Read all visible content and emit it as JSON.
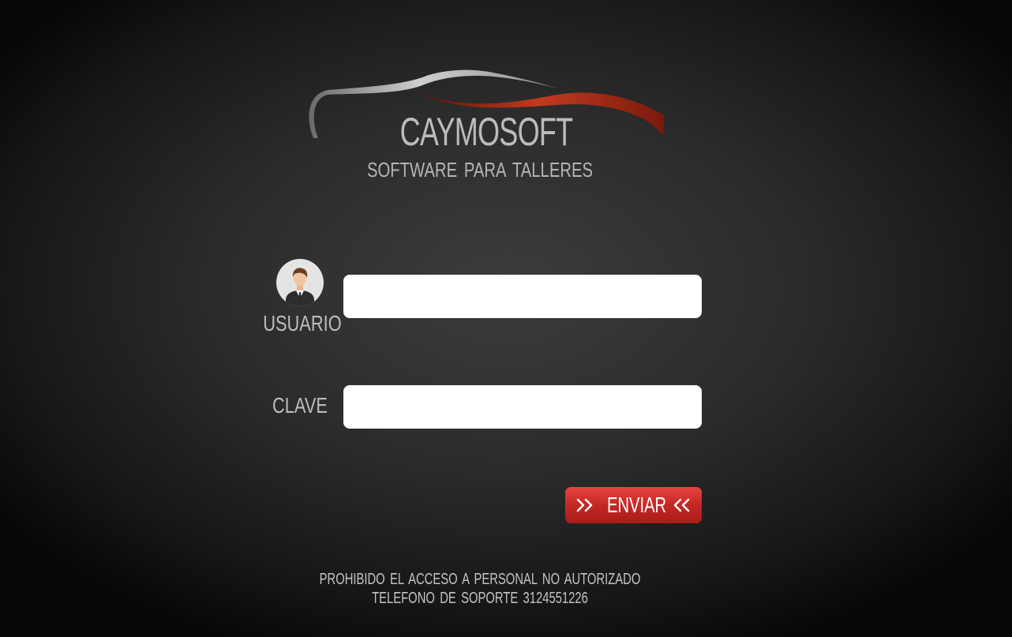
{
  "brand": {
    "name": "CAYMOSOFT",
    "tagline": "SOFTWARE PARA TALLERES",
    "logo_icon": "car-silhouette-swoosh-icon"
  },
  "form": {
    "user_label": "USUARIO",
    "user_icon": "user-avatar-icon",
    "user_value": "",
    "password_label": "CLAVE",
    "password_value": "",
    "submit_label": "ENVIAR",
    "submit_icons": [
      "double-chevron-right-icon",
      "double-chevron-left-icon"
    ]
  },
  "footer": {
    "line1": "PROHIBIDO EL ACCESO A PERSONAL NO AUTORIZADO",
    "line2": "TELEFONO DE SOPORTE 3124551226"
  },
  "colors": {
    "background": "#2c2c2c",
    "button": "#c42825",
    "swoosh_red": "#b8301c",
    "swoosh_gray": "#9a9a9a"
  }
}
